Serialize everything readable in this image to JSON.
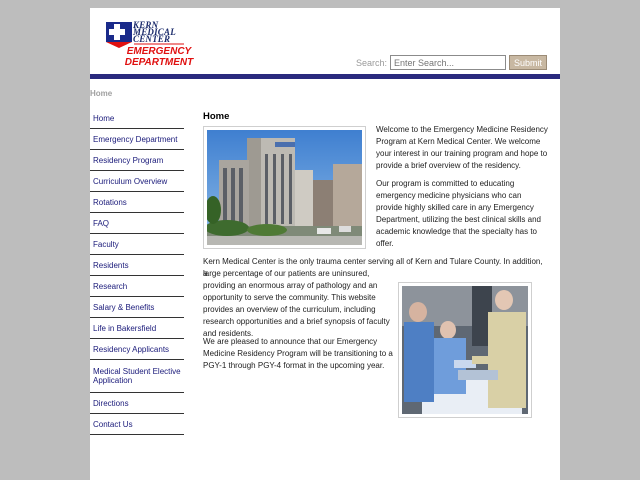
{
  "logo": {
    "line1": "KERN",
    "line2": "MEDICAL",
    "line3": "CENTER",
    "ed_line1": "EMERGENCY",
    "ed_line2": "DEPARTMENT"
  },
  "search": {
    "label": "Search:",
    "placeholder": "Enter Search...",
    "button": "Submit"
  },
  "breadcrumb": "Home",
  "sidebar": {
    "items": [
      {
        "label": "Home"
      },
      {
        "label": "Emergency Department"
      },
      {
        "label": "Residency Program"
      },
      {
        "label": "Curriculum Overview"
      },
      {
        "label": "Rotations"
      },
      {
        "label": "FAQ"
      },
      {
        "label": "Faculty"
      },
      {
        "label": "Residents"
      },
      {
        "label": "Research"
      },
      {
        "label": "Salary & Benefits"
      },
      {
        "label": "Life in Bakersfield"
      },
      {
        "label": "Residency Applicants"
      },
      {
        "label": "Medical Student Elective Application"
      },
      {
        "label": "Directions"
      },
      {
        "label": "Contact Us"
      }
    ]
  },
  "content": {
    "title": "Home",
    "p1": "Welcome to the Emergency Medicine Residency Program at Kern Medical Center. We welcome your interest in our training program and hope to provide a brief overview of the residency.",
    "p2": "Our program is committed to educating emergency medicine physicians who can provide highly skilled care in any Emergency Department, utilizing the best clinical skills and academic knowledge that the specialty has to offer.",
    "p3a": "Kern Medical Center is the only trauma center serving all of Kern and Tulare County. In addition, a",
    "p3b": "large percentage of our patients are uninsured, providing an enormous array of pathology and an opportunity to serve the community. This website provides an overview of the curriculum, including research opportunities and a brief synopsis of faculty and residents.",
    "p4": "We are pleased to announce that our Emergency Medicine Residency Program will be transitioning to a PGY-1 through PGY-4 format in the upcoming year."
  },
  "colors": {
    "header_bar": "#2a2a7e",
    "nav_text": "#1a1a7a",
    "logo_red": "#e01010",
    "logo_navy": "#1a2a6a"
  }
}
